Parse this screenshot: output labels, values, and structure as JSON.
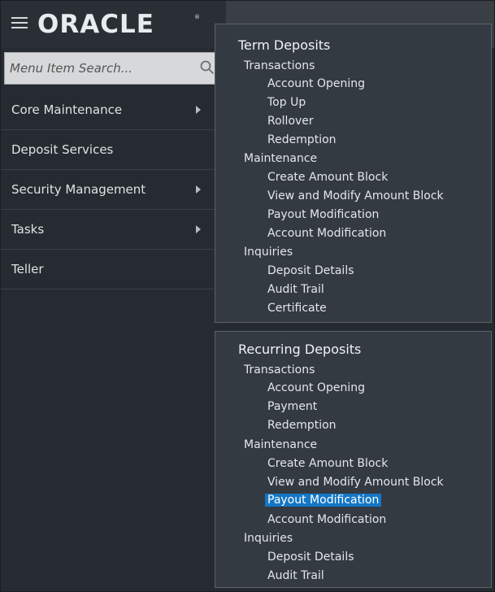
{
  "header": {
    "brand": "ORACLE",
    "brand_mark": "®"
  },
  "search": {
    "placeholder": "Menu Item Search..."
  },
  "sidebar": {
    "items": [
      {
        "label": "Core Maintenance"
      },
      {
        "label": "Deposit Services"
      },
      {
        "label": "Security Management"
      },
      {
        "label": "Tasks"
      },
      {
        "label": "Teller"
      }
    ]
  },
  "term_deposits": {
    "title": "Term Deposits",
    "transactions": {
      "label": "Transactions",
      "items": [
        "Account Opening",
        "Top Up",
        "Rollover",
        "Redemption"
      ]
    },
    "maintenance": {
      "label": "Maintenance",
      "items": [
        "Create Amount Block",
        "View and Modify Amount Block",
        "Payout Modification",
        "Account Modification"
      ]
    },
    "inquiries": {
      "label": "Inquiries",
      "items": [
        "Deposit Details",
        "Audit Trail",
        "Certificate"
      ]
    }
  },
  "recurring_deposits": {
    "title": "Recurring Deposits",
    "transactions": {
      "label": "Transactions",
      "items": [
        "Account Opening",
        "Payment",
        "Redemption"
      ]
    },
    "maintenance": {
      "label": "Maintenance",
      "items": [
        "Create Amount Block",
        "View and Modify Amount Block",
        "Payout Modification",
        "Account Modification"
      ]
    },
    "inquiries": {
      "label": "Inquiries",
      "items": [
        "Deposit Details",
        "Audit Trail"
      ]
    }
  },
  "colors": {
    "highlight": "#1477c6",
    "panel_bg": "#333a41",
    "sidebar_bg": "#262b31"
  }
}
